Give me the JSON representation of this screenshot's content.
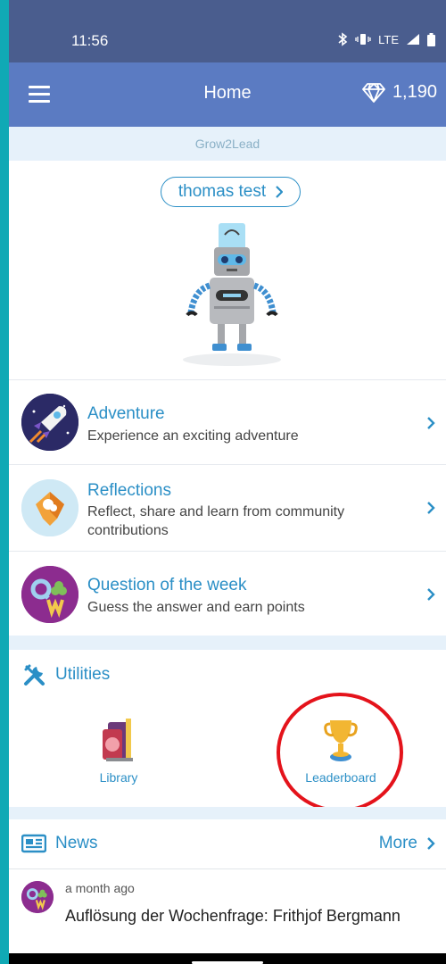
{
  "status_bar": {
    "time": "11:56",
    "network": "LTE"
  },
  "app_bar": {
    "title": "Home",
    "gems": "1,190"
  },
  "brand": "Grow2Lead",
  "profile": {
    "name": "thomas test"
  },
  "features": [
    {
      "title": "Adventure",
      "desc": "Experience an exciting adventure",
      "icon": "rocket-icon"
    },
    {
      "title": "Reflections",
      "desc": "Reflect, share and learn from community contributions",
      "icon": "reflection-icon"
    },
    {
      "title": "Question of the week",
      "desc": "Guess the answer and earn points",
      "icon": "qotw-icon"
    }
  ],
  "utilities": {
    "header": "Utilities",
    "items": [
      {
        "label": "Library",
        "icon": "library-icon"
      },
      {
        "label": "Leaderboard",
        "icon": "trophy-icon"
      }
    ]
  },
  "news": {
    "header": "News",
    "more": "More",
    "items": [
      {
        "time": "a month ago",
        "headline": "Auflösung der Wochenfrage: Frithjof Bergmann"
      }
    ]
  },
  "colors": {
    "accent": "#2b8fc6",
    "appbar": "#5b7bc2",
    "statusbar": "#4a5d8e",
    "highlight": "#e4131b",
    "frame": "#10a9b5"
  }
}
